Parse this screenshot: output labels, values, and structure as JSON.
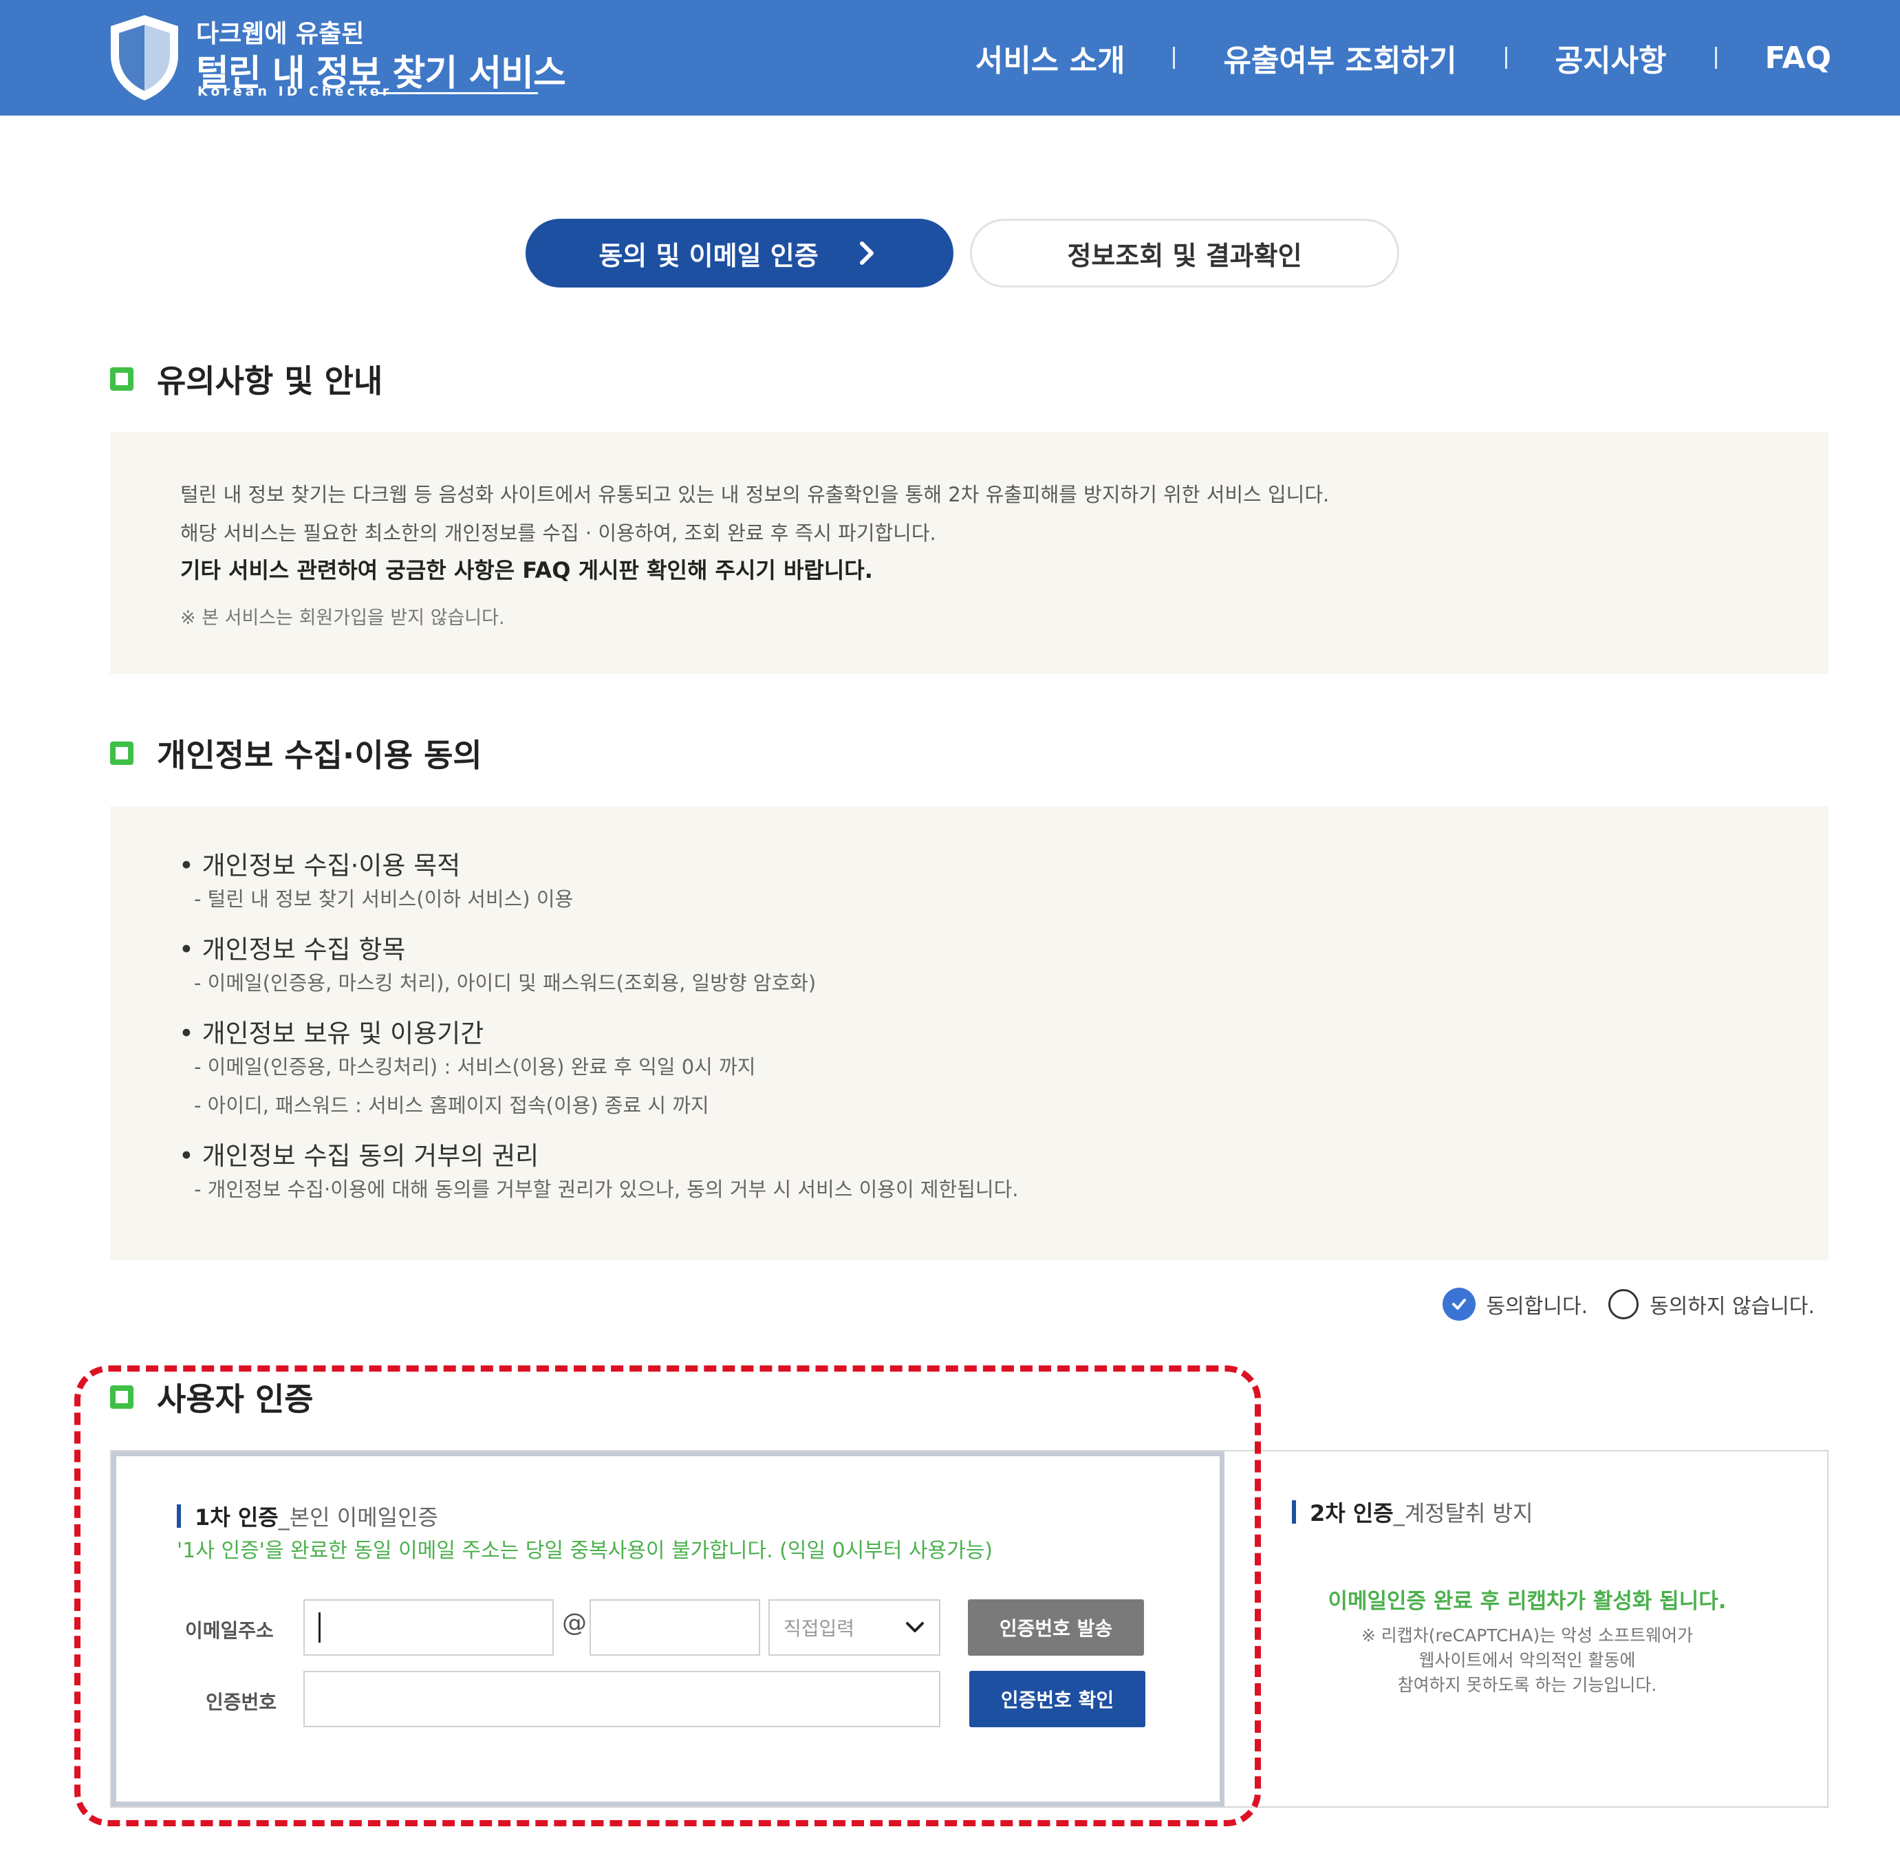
{
  "header": {
    "logo_top": "다크웹에 유출된",
    "logo_main": "털린 내 정보 찾기 서비스",
    "logo_sub": "Korean ID Checker",
    "nav": [
      "서비스 소개",
      "유출여부 조회하기",
      "공지사항",
      "FAQ"
    ]
  },
  "steps": {
    "active": "동의 및 이메일 인증",
    "inactive": "정보조회 및 결과확인"
  },
  "notice": {
    "title": "유의사항 및 안내",
    "line1": "털린 내 정보 찾기는 다크웹 등 음성화 사이트에서 유통되고 있는 내 정보의 유출확인을 통해 2차 유출피해를 방지하기 위한 서비스 입니다.",
    "line2": "해당 서비스는 필요한 최소한의 개인정보를 수집 · 이용하여, 조회 완료 후 즉시 파기합니다.",
    "line3": "기타 서비스 관련하여 궁금한 사항은 FAQ 게시판 확인해 주시기 바랍니다.",
    "line4": "※ 본 서비스는 회원가입을 받지 않습니다."
  },
  "consent": {
    "title": "개인정보 수집·이용 동의",
    "items": [
      {
        "head": "• 개인정보 수집·이용 목적",
        "subs": [
          "- 털린 내 정보 찾기 서비스(이하 서비스) 이용"
        ]
      },
      {
        "head": "• 개인정보 수집 항목",
        "subs": [
          "- 이메일(인증용, 마스킹 처리), 아이디 및 패스워드(조회용, 일방향 암호화)"
        ]
      },
      {
        "head": "• 개인정보 보유 및 이용기간",
        "subs": [
          "- 이메일(인증용, 마스킹처리) : 서비스(이용) 완료 후 익일 0시 까지",
          "- 아이디, 패스워드 : 서비스 홈페이지 접속(이용) 종료 시 까지"
        ]
      },
      {
        "head": "• 개인정보 수집 동의 거부의 권리",
        "subs": [
          "- 개인정보 수집·이용에 대해 동의를 거부할 권리가 있으나, 동의 거부 시 서비스 이용이 제한됩니다."
        ]
      }
    ],
    "agree": "동의합니다.",
    "disagree": "동의하지 않습니다.",
    "agree_selected": true
  },
  "auth": {
    "title": "사용자 인증",
    "first": {
      "title": "1차 인증",
      "title_sub": "_본인 이메일인증",
      "warning": "'1사 인증'을 완료한 동일 이메일 주소는 당일 중복사용이 불가합니다. (익일 0시부터 사용가능)",
      "email_label": "이메일주소",
      "email_local_value": "",
      "at_symbol": "@",
      "email_domain_value": "",
      "domain_select": "직접입력",
      "send_button": "인증번호 발송",
      "code_label": "인증번호",
      "code_value": "",
      "confirm_button": "인증번호 확인"
    },
    "second": {
      "title": "2차 인증",
      "title_sub": "_계정탈취 방지",
      "message": "이메일인증 완료 후 리캡차가 활성화 됩니다.",
      "note1": "※ 리캡차(reCAPTCHA)는 악성 소프트웨어가",
      "note2": "웹사이트에서 악의적인 활동에",
      "note3": "참여하지 못하도록 하는 기능입니다."
    }
  },
  "colors": {
    "header_bg": "#3f78c6",
    "primary_blue": "#1e50a2",
    "section_green": "#3fbf46",
    "highlight_red": "#dd1124",
    "panel_bg": "#f8f6f1"
  },
  "icons": [
    "shield-logo-icon",
    "chevron-right-icon",
    "check-icon",
    "chevron-down-icon"
  ]
}
